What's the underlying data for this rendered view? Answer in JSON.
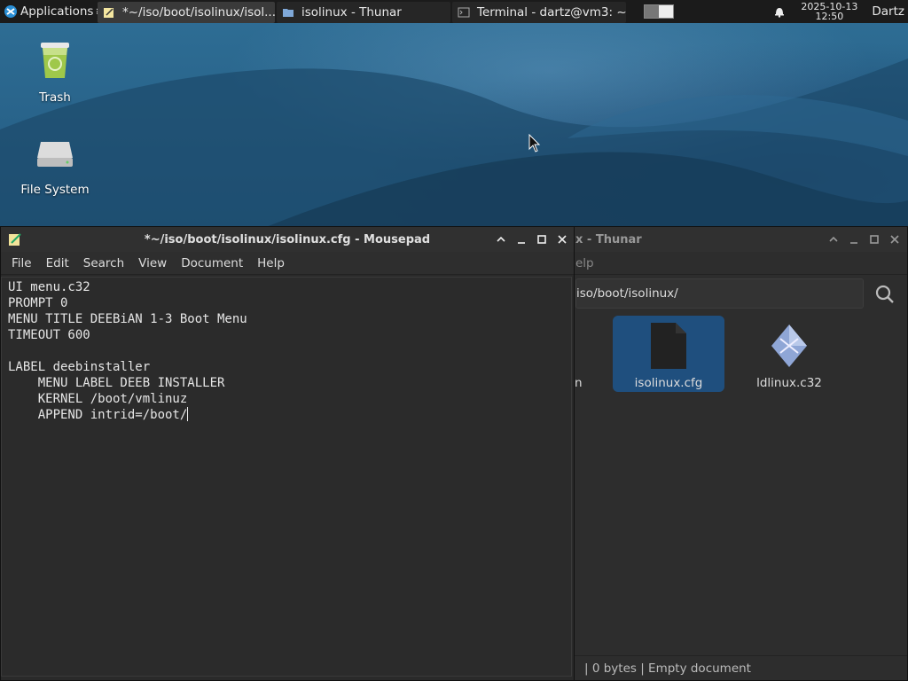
{
  "panel": {
    "applications_label": "Applications",
    "tasks": [
      {
        "label": "*~/iso/boot/isolinux/isol...",
        "icon": "text-editor-icon",
        "active": true
      },
      {
        "label": "isolinux - Thunar",
        "icon": "folder-icon",
        "active": false
      },
      {
        "label": "Terminal - dartz@vm3: ~",
        "icon": "terminal-icon",
        "active": false
      }
    ],
    "clock_date": "2025-10-13",
    "clock_time": "12:50",
    "user": "Dartz"
  },
  "desktop": {
    "icons": [
      {
        "label": "Trash",
        "icon": "trash-icon"
      },
      {
        "label": "File System",
        "icon": "drive-icon"
      }
    ]
  },
  "mousepad": {
    "title": "*~/iso/boot/isolinux/isolinux.cfg - Mousepad",
    "menu": [
      "File",
      "Edit",
      "Search",
      "View",
      "Document",
      "Help"
    ],
    "lines": [
      "UI menu.c32",
      "PROMPT 0",
      "MENU TITLE DEEBiAN 1-3 Boot Menu",
      "TIMEOUT 600",
      "",
      "LABEL deebinstaller",
      "    MENU LABEL DEEB INSTALLER",
      "    KERNEL /boot/vmlinuz",
      "    APPEND intrid=/boot/"
    ]
  },
  "thunar": {
    "title": "x - Thunar",
    "menu_partial": "elp",
    "path": "iso/boot/isolinux/",
    "files": [
      {
        "label": "isolinux.cfg",
        "icon": "text-file-icon",
        "selected": true
      },
      {
        "label": "ldlinux.c32",
        "icon": "binary-file-icon",
        "selected": false
      }
    ],
    "partial_file_label": "n",
    "status": "|  0 bytes  |  Empty document"
  },
  "colors": {
    "panel_bg": "#1b1b1b",
    "window_bg": "#2a2a2a",
    "selection": "#1f4f7e",
    "desktop": "#245b82"
  }
}
